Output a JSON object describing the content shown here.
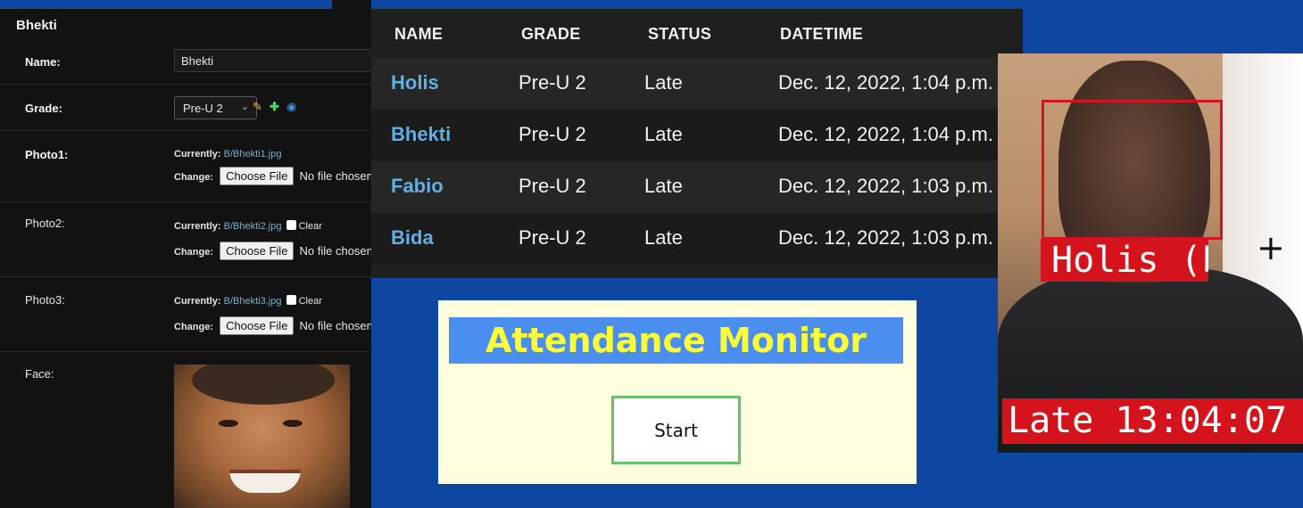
{
  "admin_form": {
    "title": "Bhekti",
    "name_label": "Name:",
    "name_value": "Bhekti",
    "grade_label": "Grade:",
    "grade_value": "Pre-U 2",
    "photo1": {
      "label": "Photo1:",
      "currently_label": "Currently:",
      "currently_file": "B/Bhekti1.jpg",
      "change_label": "Change:",
      "button": "Choose File",
      "no_file": "No file chosen"
    },
    "photo2": {
      "label": "Photo2:",
      "currently_label": "Currently:",
      "currently_file": "B/Bhekti2.jpg",
      "clear_label": "Clear",
      "change_label": "Change:",
      "button": "Choose File",
      "no_file": "No file chosen"
    },
    "photo3": {
      "label": "Photo3:",
      "currently_label": "Currently:",
      "currently_file": "B/Bhekti3.jpg",
      "clear_label": "Clear",
      "change_label": "Change:",
      "button": "Choose File",
      "no_file": "No file chosen"
    },
    "face_label": "Face:",
    "icons": [
      "pencil-icon",
      "plus-icon",
      "eye-icon"
    ]
  },
  "attendance_table": {
    "headers": [
      "NAME",
      "GRADE",
      "STATUS",
      "DATETIME"
    ],
    "rows": [
      {
        "name": "Holis",
        "grade": "Pre-U 2",
        "status": "Late",
        "datetime": "Dec. 12, 2022, 1:04 p.m."
      },
      {
        "name": "Bhekti",
        "grade": "Pre-U 2",
        "status": "Late",
        "datetime": "Dec. 12, 2022, 1:04 p.m."
      },
      {
        "name": "Fabio",
        "grade": "Pre-U 2",
        "status": "Late",
        "datetime": "Dec. 12, 2022, 1:03 p.m."
      },
      {
        "name": "Bida",
        "grade": "Pre-U 2",
        "status": "Late",
        "datetime": "Dec. 12, 2022, 1:03 p.m."
      }
    ]
  },
  "monitor": {
    "title": "Attendance Monitor",
    "start_button": "Start"
  },
  "camera": {
    "name_tag": "Holis (P",
    "status_tag": "Late 13:04:07",
    "cursor": "+"
  },
  "colors": {
    "background": "#0d47a1",
    "link": "#5eb0e5",
    "monitor_title_bg": "#4a8ef0",
    "monitor_title_text": "#ffff33",
    "detection_red": "#d4131c",
    "start_border": "#6abf69"
  }
}
